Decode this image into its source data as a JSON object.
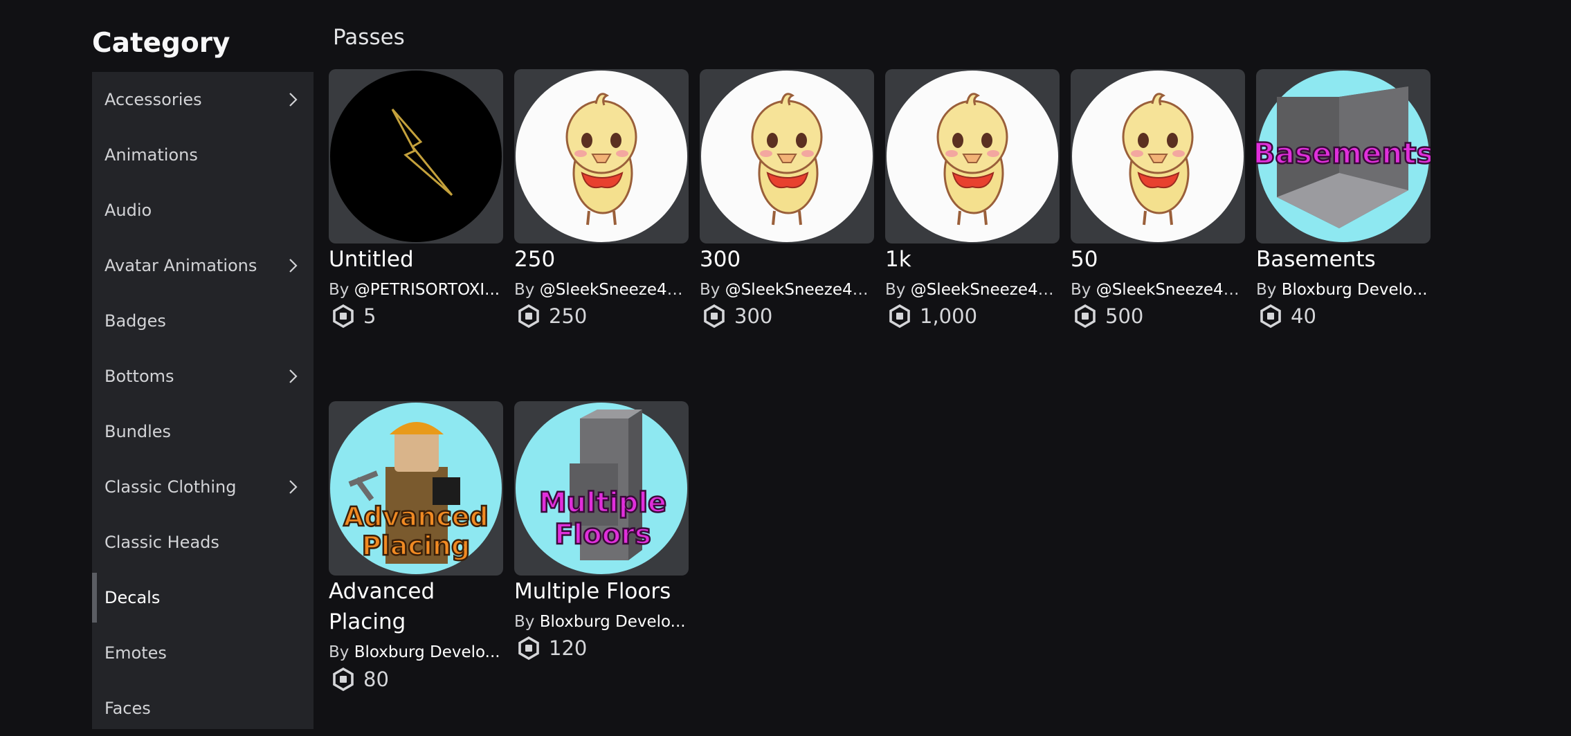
{
  "sidebar": {
    "title": "Category",
    "items": [
      {
        "label": "Accessories",
        "chevron": true
      },
      {
        "label": "Animations",
        "chevron": false
      },
      {
        "label": "Audio",
        "chevron": false
      },
      {
        "label": "Avatar Animations",
        "chevron": true
      },
      {
        "label": "Badges",
        "chevron": false
      },
      {
        "label": "Bottoms",
        "chevron": true
      },
      {
        "label": "Bundles",
        "chevron": false
      },
      {
        "label": "Classic Clothing",
        "chevron": true
      },
      {
        "label": "Classic Heads",
        "chevron": false
      },
      {
        "label": "Decals",
        "chevron": false,
        "selected": true
      },
      {
        "label": "Emotes",
        "chevron": false
      },
      {
        "label": "Faces",
        "chevron": false
      }
    ]
  },
  "main": {
    "section_title": "Passes",
    "by_prefix": "By",
    "items": [
      {
        "name": "Untitled",
        "creator": "@PETRISORTOXI...",
        "price": "5",
        "image": "lightning-bolt"
      },
      {
        "name": "250",
        "creator": "@SleekSneeze41...",
        "price": "250",
        "image": "chick"
      },
      {
        "name": "300",
        "creator": "@SleekSneeze41...",
        "price": "300",
        "image": "chick"
      },
      {
        "name": "1k",
        "creator": "@SleekSneeze41...",
        "price": "1,000",
        "image": "chick"
      },
      {
        "name": "50",
        "creator": "@SleekSneeze41...",
        "price": "500",
        "image": "chick"
      },
      {
        "name": "Basements",
        "creator": "Bloxburg Develo...",
        "price": "40",
        "image": "basement-room",
        "image_text": "Basements"
      },
      {
        "name_line1": "Advanced",
        "name_line2": "Placing",
        "creator": "Bloxburg Develo...",
        "price": "80",
        "image": "builder-avatar",
        "image_text_1": "Advanced",
        "image_text_2": "Placing"
      },
      {
        "name": "Multiple Floors",
        "creator": "Bloxburg Develo...",
        "price": "120",
        "image": "stacked-floors",
        "image_text_1": "Multiple",
        "image_text_2": "Floors"
      }
    ]
  },
  "colors": {
    "background": "#111114",
    "sidebar": "#232428",
    "thumb": "#393b3f",
    "magenta_text": "#e02fdb",
    "orange_text": "#f08a23"
  }
}
